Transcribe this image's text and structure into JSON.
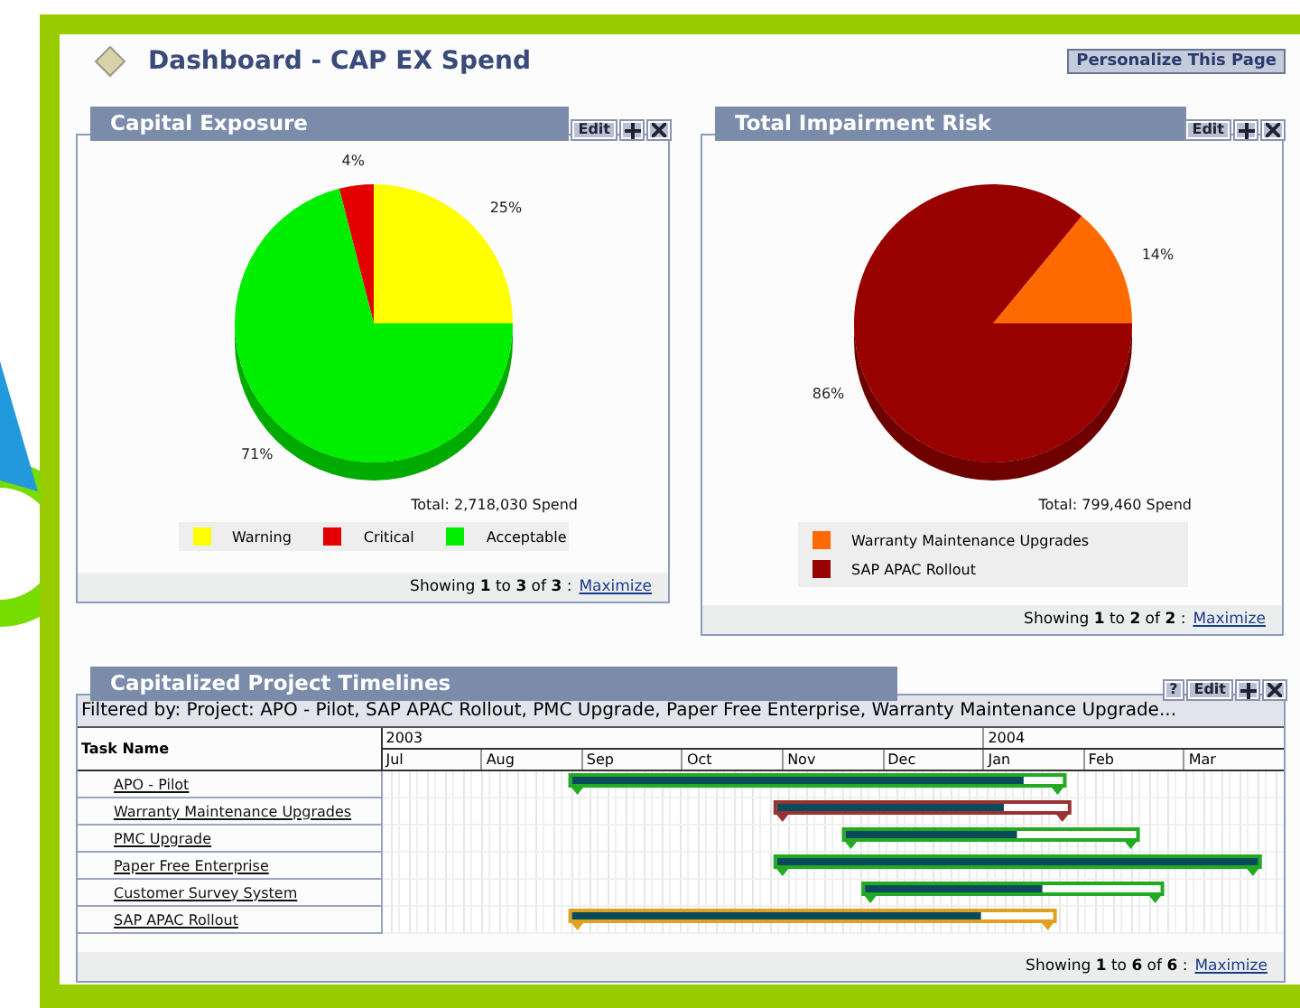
{
  "page": {
    "title": "Dashboard - CAP EX Spend",
    "personalize_button": "Personalize This Page"
  },
  "capital_exposure": {
    "title": "Capital Exposure",
    "edit_button": "Edit",
    "chart_data": {
      "type": "pie",
      "categories": [
        "Warning",
        "Critical",
        "Acceptable"
      ],
      "series": [
        {
          "values": [
            25,
            4,
            71
          ]
        }
      ],
      "colors": [
        "#ffff00",
        "#e40000",
        "#00ee00"
      ],
      "value_labels": [
        "25%",
        "4%",
        "71%"
      ]
    },
    "total": "Total: 2,718,030 Spend",
    "showing": "Showing **1** to **3** of **3** :",
    "link": "Maximize"
  },
  "total_impairment_risk": {
    "title": "Total Impairment Risk",
    "edit_button": "Edit",
    "chart_data": {
      "type": "pie",
      "categories": [
        "Warranty Maintenance Upgrades",
        "SAP APAC Rollout"
      ],
      "series": [
        {
          "values": [
            14,
            86
          ]
        }
      ],
      "colors": [
        "#ff6a00",
        "#990000"
      ],
      "value_labels": [
        "14%",
        "86%"
      ]
    },
    "total": "Total: 799,460 Spend",
    "showing": "Showing **1** to **2** of **2** :",
    "link": "Maximize"
  },
  "timelines": {
    "title": "Capitalized Project Timelines",
    "help_button": "?",
    "edit_button": "Edit",
    "filter": "Filtered by: Project: APO - Pilot, SAP APAC Rollout, PMC Upgrade, Paper Free Enterprise, Warranty Maintenance Upgrade...",
    "task_column": "Task Name",
    "years": [
      {
        "label": "2003",
        "months": [
          "Jul",
          "Aug",
          "Sep",
          "Oct",
          "Nov",
          "Dec"
        ]
      },
      {
        "label": "2004",
        "months": [
          "Jan",
          "Feb",
          "Mar"
        ]
      }
    ],
    "tasks": [
      {
        "name": "APO - Pilot",
        "level": 0.92,
        "color": "#22aa22"
      },
      {
        "name": "Warranty Maintenance Upgrades",
        "level": 0.78,
        "color": "#993333"
      },
      {
        "name": "PMC Upgrade",
        "level": 0.59,
        "color": "#22aa22"
      },
      {
        "name": "Paper Free Enterprise",
        "level": 1,
        "color": "#22aa22"
      },
      {
        "name": "Customer Survey System",
        "level": 0.6,
        "color": "#22aa22"
      },
      {
        "name": "SAP APAC Rollout",
        "level": 0.85,
        "color": "#e0a020"
      }
    ],
    "showing": "Showing **1** to **6** of **6** :",
    "link": "Maximize"
  }
}
